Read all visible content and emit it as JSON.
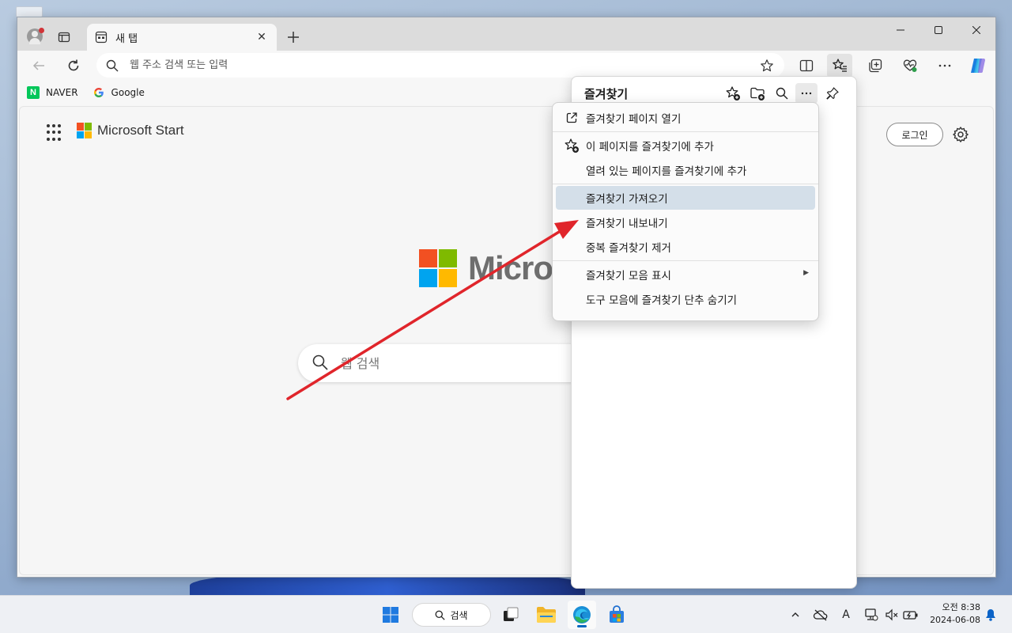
{
  "browser": {
    "tab_title": "새 탭",
    "address_placeholder": "웹 주소 검색 또는 입력"
  },
  "bookmarks": [
    {
      "label": "NAVER",
      "icon": "naver-icon"
    },
    {
      "label": "Google",
      "icon": "google-icon"
    }
  ],
  "page": {
    "brand": "Microsoft Start",
    "login_label": "로그인",
    "big_brand_partial": "Micros",
    "search_placeholder": "웹 검색"
  },
  "favorites": {
    "title": "즐겨찾기"
  },
  "context_menu": {
    "items": [
      {
        "label": "즐겨찾기 페이지 열기",
        "icon": "open-external-icon"
      },
      {
        "label": "이 페이지를 즐겨찾기에 추가",
        "icon": "star-add-icon"
      },
      {
        "label": "열려 있는 페이지를 즐겨찾기에 추가",
        "icon": ""
      },
      {
        "label": "즐겨찾기 가져오기",
        "icon": "",
        "highlighted": true
      },
      {
        "label": "즐겨찾기 내보내기",
        "icon": ""
      },
      {
        "label": "중복 즐겨찾기 제거",
        "icon": ""
      },
      {
        "label": "즐겨찾기 모음 표시",
        "icon": "",
        "submenu": true
      },
      {
        "label": "도구 모음에 즐겨찾기 단추 숨기기",
        "icon": ""
      }
    ]
  },
  "taskbar": {
    "search_label": "검색",
    "clock_time": "오전 8:38",
    "clock_date": "2024-06-08",
    "ime_label": "A"
  },
  "colors": {
    "ms_red": "#f25022",
    "ms_green": "#7fba00",
    "ms_blue": "#00a4ef",
    "ms_yellow": "#ffb900",
    "annotation_red": "#e0252b",
    "menu_highlight": "#d4dfe9"
  }
}
